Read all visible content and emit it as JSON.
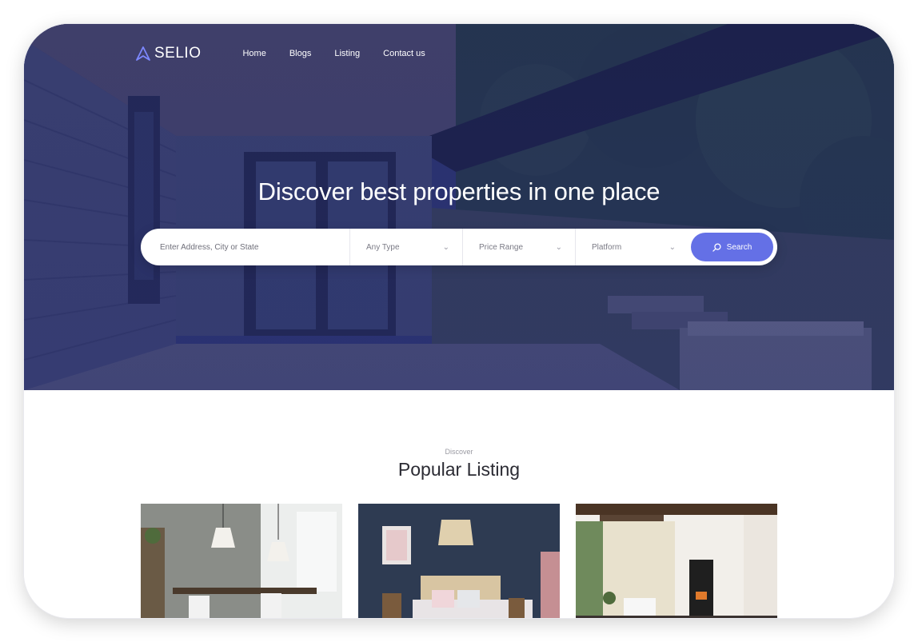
{
  "brand": {
    "name": "SELIO",
    "accent": "#6470e6"
  },
  "nav": {
    "items": [
      {
        "label": "Home"
      },
      {
        "label": "Blogs"
      },
      {
        "label": "Listing"
      },
      {
        "label": "Contact us"
      }
    ]
  },
  "hero": {
    "headline": "Discover best properties in one place",
    "background_overlay": "#232a6e"
  },
  "search": {
    "address_placeholder": "Enter Address, City or State",
    "type_selected": "Any Type",
    "price_selected": "Price Range",
    "platform_selected": "Platform",
    "button_label": "Search",
    "button_icon": "search-icon",
    "select_icon": "chevron-down-icon"
  },
  "popular": {
    "eyebrow": "Discover",
    "title": "Popular Listing",
    "cards": [
      {
        "image": "dining-room-photo"
      },
      {
        "image": "bedroom-photo"
      },
      {
        "image": "living-room-fireplace-photo"
      }
    ]
  }
}
